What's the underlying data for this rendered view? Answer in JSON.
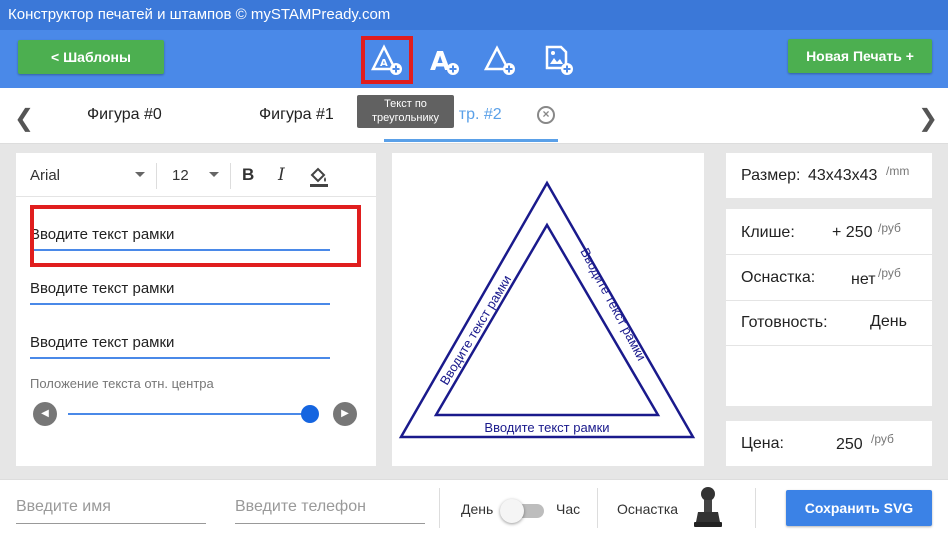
{
  "titlebar": {
    "title": "Конструктор печатей и штампов © mySTAMPready.com"
  },
  "toolbar": {
    "templates_label": "<   Шаблоны",
    "new_stamp_label": "Новая Печать +",
    "tooltip": "Текст по треугольнику",
    "tools": [
      {
        "icon": "triangle-text-add-icon",
        "active": true
      },
      {
        "icon": "text-add-icon",
        "active": false
      },
      {
        "icon": "triangle-add-icon",
        "active": false
      },
      {
        "icon": "image-add-icon",
        "active": false
      }
    ]
  },
  "tabs": {
    "items": [
      {
        "label": "Фигура #0"
      },
      {
        "label": "Фигура #1"
      },
      {
        "label": "ст тр. #2"
      }
    ]
  },
  "editor": {
    "font": "Arial",
    "size": "12",
    "bold": "B",
    "italic": "I",
    "lines": [
      "Вводите текст рамки",
      "Вводите текст рамки",
      "Вводите текст рамки"
    ],
    "position_label": "Положение текста отн. центра",
    "slider_value": 1.0
  },
  "canvas": {
    "left_text": "Вводите текст рамки",
    "right_text": "Вводите текст рамки",
    "bottom_text": "Вводите текст рамки",
    "color": "#1a1a8c"
  },
  "info": {
    "size_label": "Размер:",
    "size_value": "43x43x43",
    "size_unit": "/mm",
    "cliche_label": "Клише:",
    "cliche_value": "+ 250",
    "cliche_unit": "/руб",
    "mount_label": "Оснастка:",
    "mount_value": "нет",
    "mount_unit": "/руб",
    "ready_label": "Готовность:",
    "ready_value": "День",
    "price_label": "Цена:",
    "price_value": "250",
    "price_unit": "/руб"
  },
  "footer": {
    "name_placeholder": "Введите имя",
    "phone_placeholder": "Введите телефон",
    "day_label": "День",
    "hour_label": "Час",
    "mount_label": "Оснастка",
    "save_label": "Сохранить SVG"
  }
}
